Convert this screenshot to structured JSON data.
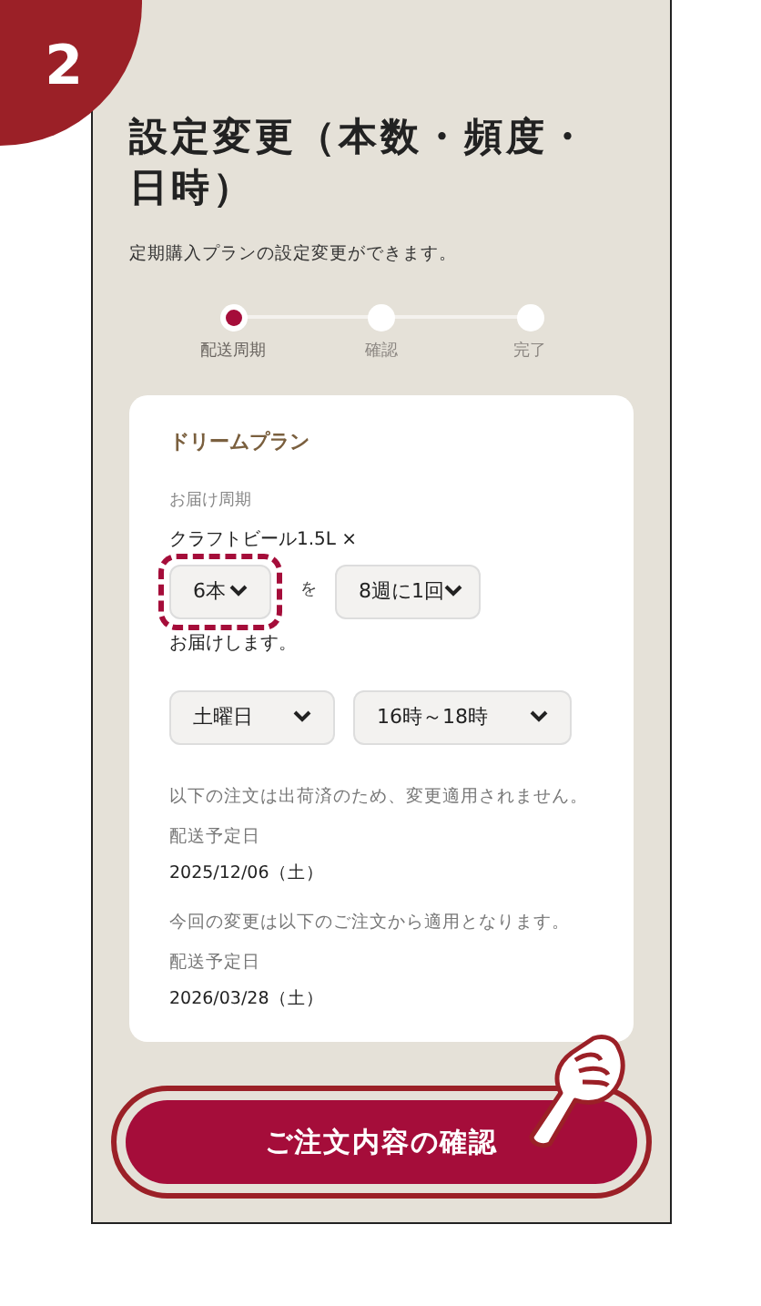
{
  "step_badge": "2",
  "title": "設定変更（本数・頻度・日時）",
  "subtitle": "定期購入プランの設定変更ができます。",
  "steps": [
    {
      "label": "配送周期",
      "selected": true
    },
    {
      "label": "確認",
      "selected": false
    },
    {
      "label": "完了",
      "selected": false
    }
  ],
  "card": {
    "plan_name": "ドリームプラン",
    "cycle_label": "お届け周期",
    "product": "クラフトビール1.5L ×",
    "quantity_select": {
      "value": "6本",
      "highlight": true
    },
    "connector": "を",
    "frequency_select": {
      "value": "8週に1回"
    },
    "deliver_text": "お届けします。",
    "day_select": {
      "value": "土曜日"
    },
    "time_select": {
      "value": "16時～18時"
    },
    "notes": [
      {
        "message": "以下の注文は出荷済のため、変更適用されません。",
        "date_label": "配送予定日",
        "date": "2025/12/06（土）"
      },
      {
        "message": "今回の変更は以下のご注文から適用となります。",
        "date_label": "配送予定日",
        "date": "2026/03/28（土）"
      }
    ]
  },
  "confirm_button": {
    "label": "ご注文内容の確認",
    "highlight": true
  }
}
